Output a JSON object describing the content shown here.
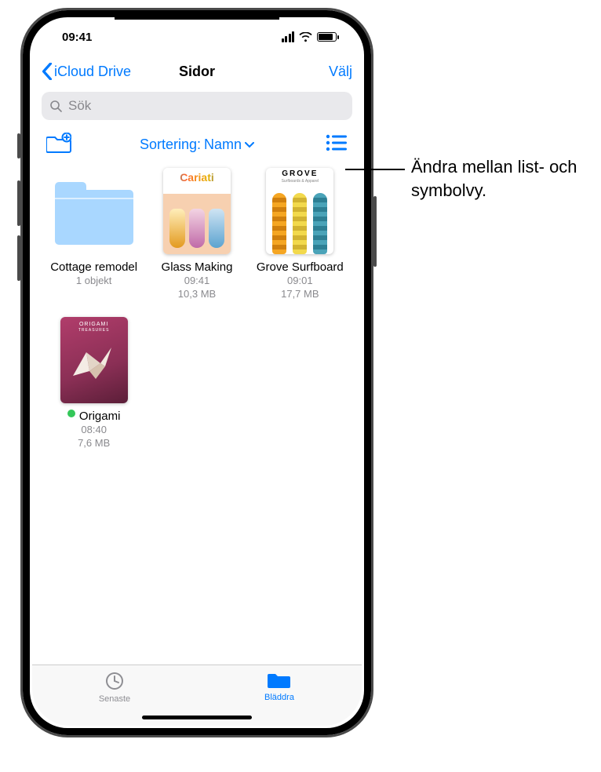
{
  "statusbar": {
    "time": "09:41"
  },
  "nav": {
    "back": "iCloud Drive",
    "title": "Sidor",
    "select": "Välj"
  },
  "search": {
    "placeholder": "Sök"
  },
  "toolbar": {
    "sort_prefix": "Sortering: ",
    "sort_value": "Namn"
  },
  "items": [
    {
      "type": "folder",
      "name": "Cottage remodel",
      "meta1": "1 objekt",
      "meta2": ""
    },
    {
      "type": "doc",
      "style": "cariati",
      "name": "Glass Making",
      "meta1": "09:41",
      "meta2": "10,3 MB"
    },
    {
      "type": "doc",
      "style": "grove",
      "name": "Grove Surfboard",
      "meta1": "09:01",
      "meta2": "17,7 MB"
    },
    {
      "type": "doc",
      "style": "origami",
      "name": "Origami",
      "meta1": "08:40",
      "meta2": "7,6 MB",
      "badge": "green"
    }
  ],
  "tabs": {
    "recent": "Senaste",
    "browse": "Bläddra",
    "active": "browse"
  },
  "callout": {
    "text": "Ändra mellan list- och symbolvy."
  },
  "colors": {
    "accent": "#007aff"
  }
}
